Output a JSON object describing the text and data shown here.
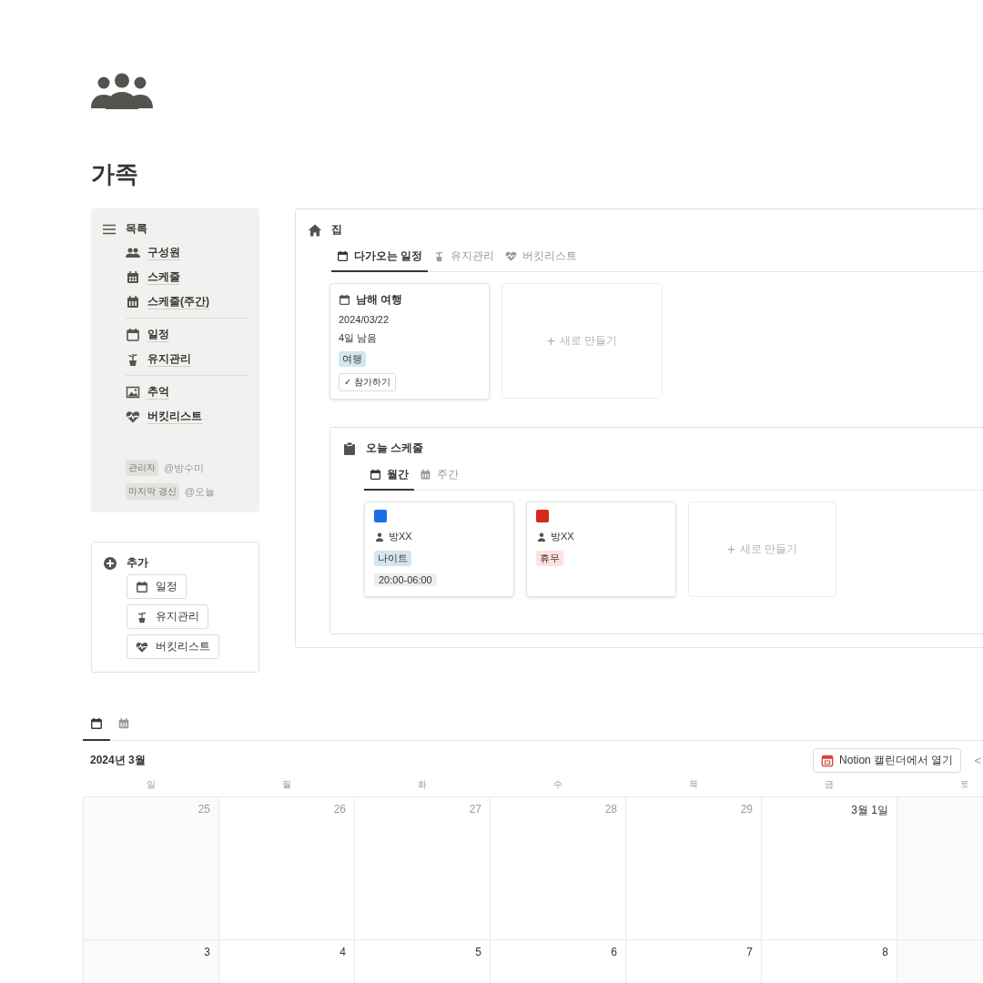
{
  "page": {
    "title": "가족"
  },
  "nav": {
    "title": "목록",
    "sections": [
      {
        "items": [
          {
            "label": "구성원"
          },
          {
            "label": "스케줄"
          },
          {
            "label": "스케줄(주간)"
          }
        ]
      },
      {
        "items": [
          {
            "label": "일정"
          },
          {
            "label": "유지관리"
          }
        ]
      },
      {
        "items": [
          {
            "label": "추억"
          },
          {
            "label": "버킷리스트"
          }
        ]
      }
    ],
    "properties": [
      {
        "name": "관리자",
        "value": "@방수미"
      },
      {
        "name": "마지막 경신",
        "value": "@오늘"
      }
    ]
  },
  "add": {
    "title": "추가",
    "buttons": [
      "일정",
      "유지관리",
      "버킷리스트"
    ]
  },
  "home": {
    "title": "집",
    "tabs": [
      {
        "label": "다가오는 일정",
        "selected": true
      },
      {
        "label": "유지관리",
        "selected": false
      },
      {
        "label": "버킷리스트",
        "selected": false
      }
    ],
    "cards": [
      {
        "title": "남해 여행",
        "date": "2024/03/22",
        "remaining": "4일 남음",
        "tag": {
          "label": "여행",
          "color": "#d3e5ef"
        },
        "action": "✓ 참가하기"
      }
    ],
    "new_card": {
      "plus": "+",
      "label": "새로 만들기"
    },
    "schedule": {
      "title": "오늘 스케줄",
      "tabs": [
        {
          "label": "월간",
          "selected": true
        },
        {
          "label": "주간",
          "selected": false
        }
      ],
      "cards": [
        {
          "color": "#1a6ee8",
          "person": "방XX",
          "tag": {
            "label": "나이트",
            "color": "#d3e5ef"
          },
          "time": "20:00-06:00"
        },
        {
          "color": "#d4291d",
          "person": "방XX",
          "tag": {
            "label": "휴무",
            "color": "#ffe2dd"
          }
        }
      ],
      "new_card": {
        "plus": "+",
        "label": "새로 만들기"
      }
    }
  },
  "calendar": {
    "views": [
      {
        "selected": true
      },
      {
        "selected": false
      }
    ],
    "month": "2024년 3월",
    "open_button": "Notion 캘린더에서 열기",
    "prev": "<",
    "weekdays": [
      "일",
      "월",
      "화",
      "수",
      "목",
      "금",
      "토"
    ],
    "weeks": [
      {
        "days": [
          {
            "label": "25",
            "outside": true
          },
          {
            "label": "26",
            "outside": true
          },
          {
            "label": "27",
            "outside": true
          },
          {
            "label": "28",
            "outside": true
          },
          {
            "label": "29",
            "outside": true
          },
          {
            "label": "3월 1일",
            "outside": false
          }
        ]
      },
      {
        "days": [
          {
            "label": "3",
            "outside": false
          },
          {
            "label": "4",
            "outside": false
          },
          {
            "label": "5",
            "outside": false
          },
          {
            "label": "6",
            "outside": false
          },
          {
            "label": "7",
            "outside": false
          },
          {
            "label": "8",
            "outside": false
          }
        ]
      }
    ]
  }
}
